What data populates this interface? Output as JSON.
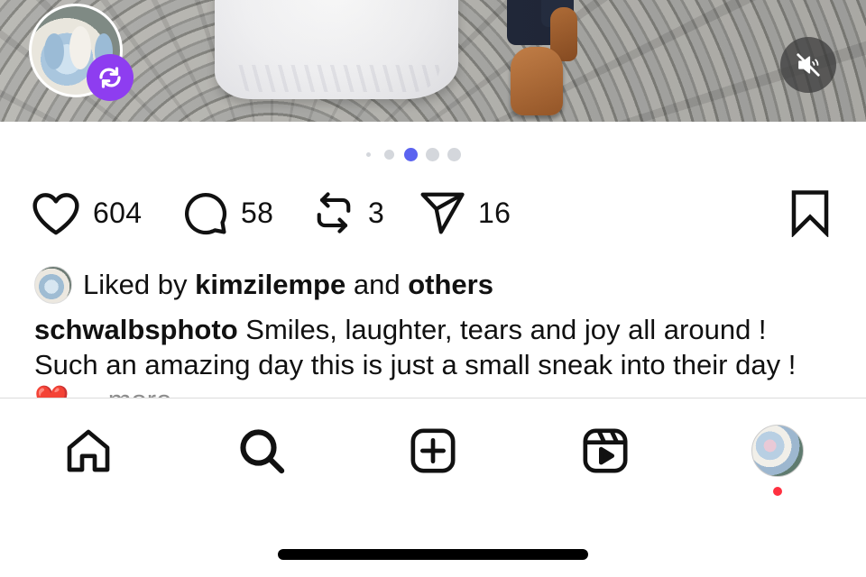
{
  "post": {
    "media_index": 3,
    "media_count": 5,
    "accent_color": "#5b63f0",
    "media_audio": "muted"
  },
  "actions": {
    "likes_count": "604",
    "comments_count": "58",
    "reposts_count": "3",
    "shares_count": "16"
  },
  "liked_by": {
    "prefix": "Liked by",
    "user": "kimzilempe",
    "joiner": "and",
    "others": "others"
  },
  "caption": {
    "username": "schwalbsphoto",
    "text": "Smiles, laughter, tears and joy all around ! Such an amazing day this is just a small sneak into their day ! ",
    "emoji": "❤️",
    "ellipsis": "...",
    "more": "more"
  },
  "icons": {
    "like": "heart-icon",
    "comment": "comment-icon",
    "repost": "repost-icon",
    "share": "send-icon",
    "save": "bookmark-icon",
    "remix": "remix-icon",
    "mute": "speaker-muted-icon"
  },
  "nav": {
    "items": [
      {
        "name": "home",
        "icon": "home-icon"
      },
      {
        "name": "search",
        "icon": "search-icon"
      },
      {
        "name": "create",
        "icon": "plus-square-icon"
      },
      {
        "name": "reels",
        "icon": "reels-icon"
      },
      {
        "name": "profile",
        "icon": "profile-avatar"
      }
    ],
    "notification_color": "#ff3040"
  }
}
